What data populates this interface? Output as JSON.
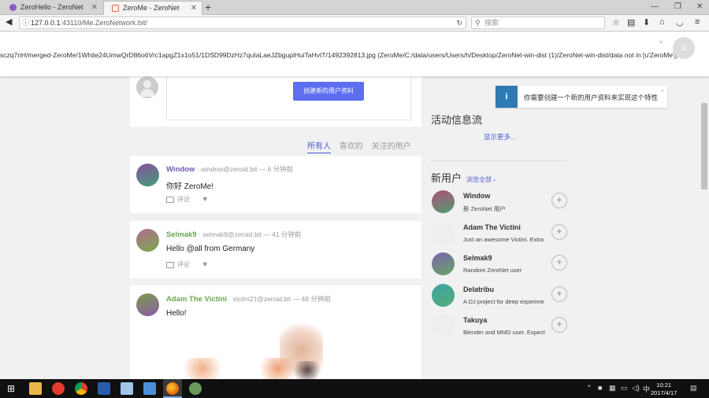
{
  "browser": {
    "tabs": [
      {
        "title": "ZeroHello - ZeroNet",
        "close": "✕"
      },
      {
        "title": "ZeroMe - ZeroNet",
        "close": "✕"
      }
    ],
    "new_tab": "+",
    "window_controls": {
      "minimize": "—",
      "restore": "❐",
      "close": "✕"
    },
    "url_host": "127.0.0.1",
    "url_path": ":43110/Me.ZeroNetwork.bit/",
    "search_placeholder": "搜索"
  },
  "notice": {
    "error_text": "sczq7nH/merged-ZeroMe/1White24UmwQrD86o6Vrc1apgZ1x1o51/1DSD99DzHz7quIaLaeJZbgupiHuiTaHvtT/1492392813.jpg (ZeroMe/C:/data/users/Users/h/Desktop/ZeroNet-win-dist (1)/ZeroNet-win-dist/data not in [u'ZeroMe'])",
    "close": "×",
    "badge": "0"
  },
  "composer": {
    "button_label": "创建新的用户资料"
  },
  "filters": {
    "all": "所有人",
    "liked": "喜欢的",
    "followed": "关注的用户"
  },
  "posts": [
    {
      "name": "Window",
      "meta": " · window@zeroid.bit — 6 分钟前",
      "body": "你好 ZeroMe!",
      "comment": "评论",
      "name_color": "#6f5bb0",
      "avatar": [
        "#8b4f9e",
        "#3fa07d"
      ]
    },
    {
      "name": "Selmak9",
      "meta": " · selmak9@zeroid.bit — 41 分钟前",
      "body": "Hello @all from Germany",
      "comment": "评论",
      "name_color": "#6aa84f",
      "avatar": [
        "#b26d8c",
        "#78a84e"
      ]
    },
    {
      "name": "Adam The Victini",
      "meta": " · victini21@zeroid.bit — 48 分钟前",
      "body": "Hello!",
      "name_color": "#6aa84f",
      "avatar": [
        "#7b9e4a",
        "#8b5aa8"
      ]
    }
  ],
  "right": {
    "toast_text": "你需要创建一个新的用户资料来实现这个特性",
    "toast_icon": "i",
    "toast_close": "×",
    "activity_title": "活动信息流",
    "show_more": "显示更多...",
    "new_users_title": "新用户",
    "browse_all": "浏览全部 ›",
    "users": [
      {
        "name": "Window",
        "desc": "新 ZeroNet 用户",
        "avatar": [
          "#b04f7a",
          "#4f9e70"
        ]
      },
      {
        "name": "Adam The Victini",
        "desc": "Just an awesome Victini. Extra",
        "avatar": [
          "#eeeeee",
          "#eeeeee"
        ]
      },
      {
        "name": "Selmak9",
        "desc": "Random ZeroNet user",
        "avatar": [
          "#7a62b0",
          "#68a860"
        ]
      },
      {
        "name": "Delatribu",
        "desc": "A DJ project for deep experime",
        "avatar": [
          "#3fa3a0",
          "#4fae7a"
        ]
      },
      {
        "name": "Takuya",
        "desc": "Blender and MMD user. Expect",
        "avatar": [
          "#eeeeee",
          "#eeeeee"
        ]
      }
    ],
    "add": "+"
  },
  "taskbar": {
    "time": "10:21",
    "date": "2017/4/17"
  }
}
